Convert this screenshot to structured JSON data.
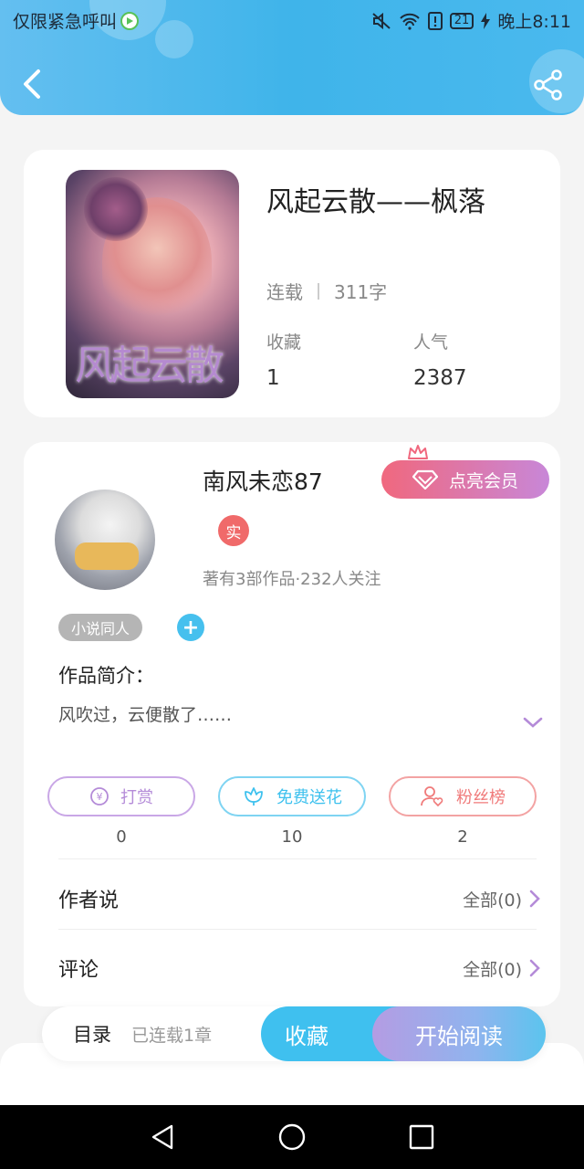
{
  "status_bar": {
    "left_text": "仅限紧急呼叫",
    "battery": "21",
    "time": "晚上8:11"
  },
  "header": {
    "back_icon": "chevron-left-icon",
    "share_icon": "share-icon"
  },
  "book": {
    "title": "风起云散——枫落",
    "cover_text": "风起云散",
    "status": "连载",
    "word_count": "311字",
    "favorites_label": "收藏",
    "favorites_value": "1",
    "popularity_label": "人气",
    "popularity_value": "2387"
  },
  "author": {
    "name": "南风未恋87",
    "vip_label": "点亮会员",
    "real_badge": "实",
    "stats": "著有3部作品·232人关注",
    "tag": "小说同人",
    "add_tag_symbol": "+"
  },
  "intro": {
    "label": "作品简介：",
    "text": "风吹过，云便散了……"
  },
  "actions": [
    {
      "label": "打赏",
      "count": "0",
      "icon": "yen-coin-icon",
      "color": "#b48bd8"
    },
    {
      "label": "免费送花",
      "count": "10",
      "icon": "flower-icon",
      "color": "#3ec1ee"
    },
    {
      "label": "粉丝榜",
      "count": "2",
      "icon": "fan-user-icon",
      "color": "#f07a7a"
    }
  ],
  "sections": {
    "author_says": {
      "title": "作者说",
      "more": "全部(0)"
    },
    "comments": {
      "title": "评论",
      "more": "全部(0)"
    }
  },
  "bottom": {
    "toc_label": "目录",
    "toc_status": "已连载1章",
    "collect_label": "收藏",
    "read_label": "开始阅读"
  },
  "nav": {
    "back": "triangle-back-icon",
    "home": "circle-home-icon",
    "recents": "square-recents-icon"
  }
}
